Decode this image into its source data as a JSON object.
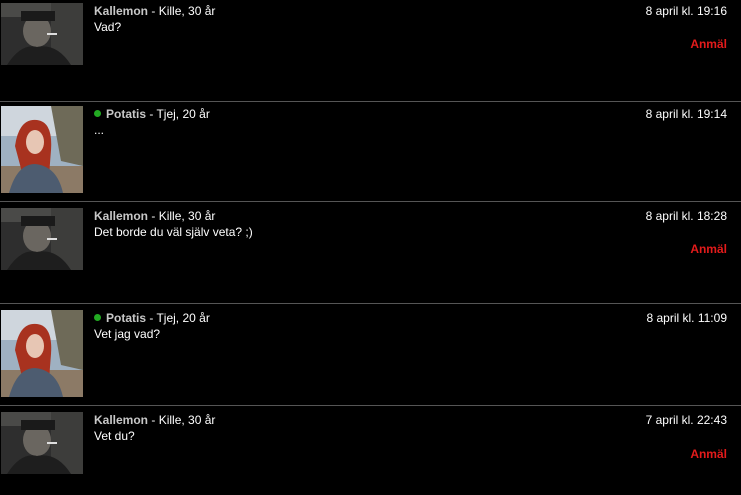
{
  "colors": {
    "background": "#000000",
    "divider": "#555555",
    "name": "#c8c8c8",
    "report": "#e31b1b",
    "online": "#22aa22"
  },
  "messages": [
    {
      "name": "Kallemon",
      "meta": "- Kille, 30 år",
      "online": false,
      "text": "Vad?",
      "time": "8 april kl. 19:16",
      "report": "Anmäl"
    },
    {
      "name": "Potatis",
      "meta": "- Tjej, 20 år",
      "online": true,
      "text": "...",
      "time": "8 april kl. 19:14",
      "report": null
    },
    {
      "name": "Kallemon",
      "meta": "- Kille, 30 år",
      "online": false,
      "text": "Det borde du väl själv veta? ;)",
      "time": "8 april kl. 18:28",
      "report": "Anmäl"
    },
    {
      "name": "Potatis",
      "meta": "- Tjej, 20 år",
      "online": true,
      "text": "Vet jag vad?",
      "time": "8 april kl. 11:09",
      "report": null
    },
    {
      "name": "Kallemon",
      "meta": "- Kille, 30 år",
      "online": false,
      "text": "Vet du?",
      "time": "7 april kl. 22:43",
      "report": "Anmäl"
    }
  ]
}
